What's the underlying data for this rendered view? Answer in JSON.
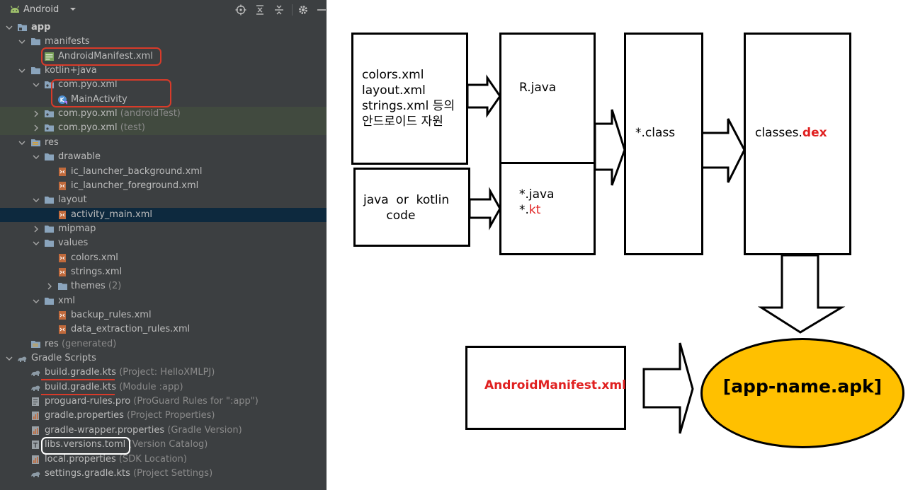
{
  "toolbar": {
    "title": "Android"
  },
  "tree": [
    {
      "label": "app",
      "suffix": "",
      "bold": true,
      "indent": 0,
      "chev": "down",
      "icon": "module-folder-icon",
      "hl": ""
    },
    {
      "label": "manifests",
      "suffix": "",
      "indent": 1,
      "chev": "down",
      "icon": "folder-icon",
      "hl": ""
    },
    {
      "label": "AndroidManifest.xml",
      "suffix": "",
      "indent": 2,
      "chev": "",
      "icon": "manifest-file-icon",
      "hl": ""
    },
    {
      "label": "kotlin+java",
      "suffix": "",
      "indent": 1,
      "chev": "down",
      "icon": "folder-icon",
      "hl": ""
    },
    {
      "label": "com.pyo.xml",
      "suffix": "",
      "indent": 2,
      "chev": "down",
      "icon": "package-icon",
      "hl": ""
    },
    {
      "label": "MainActivity",
      "suffix": "",
      "indent": 3,
      "chev": "",
      "icon": "kotlin-class-icon",
      "hl": ""
    },
    {
      "label": "com.pyo.xml",
      "suffix": " (androidTest)",
      "indent": 2,
      "chev": "right",
      "icon": "package-icon",
      "hl": "green"
    },
    {
      "label": "com.pyo.xml",
      "suffix": " (test)",
      "indent": 2,
      "chev": "right",
      "icon": "package-icon",
      "hl": "green"
    },
    {
      "label": "res",
      "suffix": "",
      "indent": 1,
      "chev": "down",
      "icon": "res-folder-icon",
      "hl": ""
    },
    {
      "label": "drawable",
      "suffix": "",
      "indent": 2,
      "chev": "down",
      "icon": "folder-icon",
      "hl": ""
    },
    {
      "label": "ic_launcher_background.xml",
      "suffix": "",
      "indent": 3,
      "chev": "",
      "icon": "xml-file-icon",
      "hl": ""
    },
    {
      "label": "ic_launcher_foreground.xml",
      "suffix": "",
      "indent": 3,
      "chev": "",
      "icon": "xml-file-icon",
      "hl": ""
    },
    {
      "label": "layout",
      "suffix": "",
      "indent": 2,
      "chev": "down",
      "icon": "folder-icon",
      "hl": ""
    },
    {
      "label": "activity_main.xml",
      "suffix": "",
      "indent": 3,
      "chev": "",
      "icon": "xml-file-icon",
      "hl": "sel"
    },
    {
      "label": "mipmap",
      "suffix": "",
      "indent": 2,
      "chev": "right",
      "icon": "folder-icon",
      "hl": ""
    },
    {
      "label": "values",
      "suffix": "",
      "indent": 2,
      "chev": "down",
      "icon": "folder-icon",
      "hl": ""
    },
    {
      "label": "colors.xml",
      "suffix": "",
      "indent": 3,
      "chev": "",
      "icon": "xml-file-icon",
      "hl": ""
    },
    {
      "label": "strings.xml",
      "suffix": "",
      "indent": 3,
      "chev": "",
      "icon": "xml-file-icon",
      "hl": ""
    },
    {
      "label": "themes",
      "suffix": " (2)",
      "indent": 3,
      "chev": "right",
      "icon": "folder-icon",
      "hl": ""
    },
    {
      "label": "xml",
      "suffix": "",
      "indent": 2,
      "chev": "down",
      "icon": "folder-icon",
      "hl": ""
    },
    {
      "label": "backup_rules.xml",
      "suffix": "",
      "indent": 3,
      "chev": "",
      "icon": "xml-file-icon",
      "hl": ""
    },
    {
      "label": "data_extraction_rules.xml",
      "suffix": "",
      "indent": 3,
      "chev": "",
      "icon": "xml-file-icon",
      "hl": ""
    },
    {
      "label": "res",
      "suffix": " (generated)",
      "indent": 1,
      "chev": "",
      "icon": "res-folder-icon",
      "hl": ""
    },
    {
      "label": "Gradle Scripts",
      "suffix": "",
      "indent": 0,
      "chev": "down",
      "icon": "gradle-icon",
      "hl": ""
    },
    {
      "label": "build.gradle.kts",
      "suffix": " (Project: HelloXMLPJ)",
      "indent": 1,
      "chev": "",
      "icon": "gradle-icon",
      "hl": ""
    },
    {
      "label": "build.gradle.kts",
      "suffix": " (Module :app)",
      "indent": 1,
      "chev": "",
      "icon": "gradle-icon",
      "hl": ""
    },
    {
      "label": "proguard-rules.pro",
      "suffix": " (ProGuard Rules for \":app\")",
      "indent": 1,
      "chev": "",
      "icon": "text-file-icon",
      "hl": ""
    },
    {
      "label": "gradle.properties",
      "suffix": " (Project Properties)",
      "indent": 1,
      "chev": "",
      "icon": "properties-file-icon",
      "hl": ""
    },
    {
      "label": "gradle-wrapper.properties",
      "suffix": " (Gradle Version)",
      "indent": 1,
      "chev": "",
      "icon": "properties-file-icon",
      "hl": ""
    },
    {
      "label": "libs.versions.toml",
      "suffix": " (Version Catalog)",
      "indent": 1,
      "chev": "",
      "icon": "toml-file-icon",
      "hl": ""
    },
    {
      "label": "local.properties",
      "suffix": " (SDK Location)",
      "indent": 1,
      "chev": "",
      "icon": "properties-file-icon",
      "hl": ""
    },
    {
      "label": "settings.gradle.kts",
      "suffix": " (Project Settings)",
      "indent": 1,
      "chev": "",
      "icon": "gradle-icon",
      "hl": ""
    }
  ],
  "diagram": {
    "resources": "colors.xml\nlayout.xml\nstrings.xml 등의\n안드로이드 자원",
    "source": "java  or  kotlin\n      code",
    "r_java": "R.java",
    "java_ext": "*.java",
    "kt_prefix": "*.",
    "kt_ext": "kt",
    "class": "*.class",
    "classes_prefix": "classes.",
    "classes_ext": "dex",
    "manifest": "AndroidManifest.xml",
    "apk": "[app-name.apk]"
  },
  "colors": {
    "panel_bg": "#3c3f41",
    "highlight_red": "#e02020",
    "apk_fill": "#ffc000",
    "annotation_red": "#d83b2a"
  }
}
